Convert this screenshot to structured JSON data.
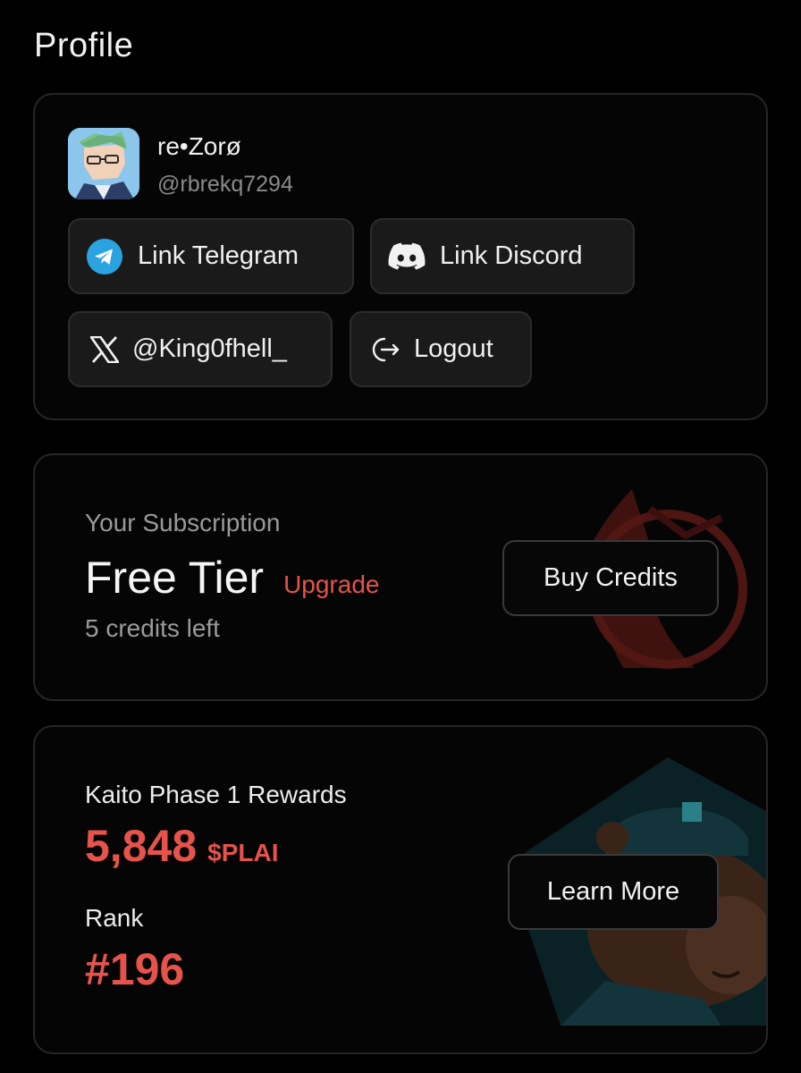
{
  "page": {
    "title": "Profile"
  },
  "profile": {
    "display_name": "re•Zorø",
    "username": "@rbrekq7294",
    "buttons": {
      "telegram": "Link Telegram",
      "discord": "Link Discord",
      "x_handle": "@King0fhell_",
      "logout": "Logout"
    },
    "icons": {
      "telegram": "telegram-icon",
      "discord": "discord-icon",
      "x": "x-logo-icon",
      "logout": "logout-icon"
    }
  },
  "subscription": {
    "label": "Your Subscription",
    "tier": "Free Tier",
    "upgrade_label": "Upgrade",
    "credits_left": "5 credits left",
    "buy_credits_label": "Buy Credits"
  },
  "rewards": {
    "label": "Kaito Phase 1 Rewards",
    "amount": "5,848",
    "token": "$PLAI",
    "rank_label": "Rank",
    "rank_value": "#196",
    "learn_more_label": "Learn More"
  },
  "colors": {
    "background": "#000000",
    "card_border": "#262626",
    "accent_red": "#e5534b",
    "telegram_blue": "#2aa3e0",
    "muted_text": "#9a9a9a"
  }
}
